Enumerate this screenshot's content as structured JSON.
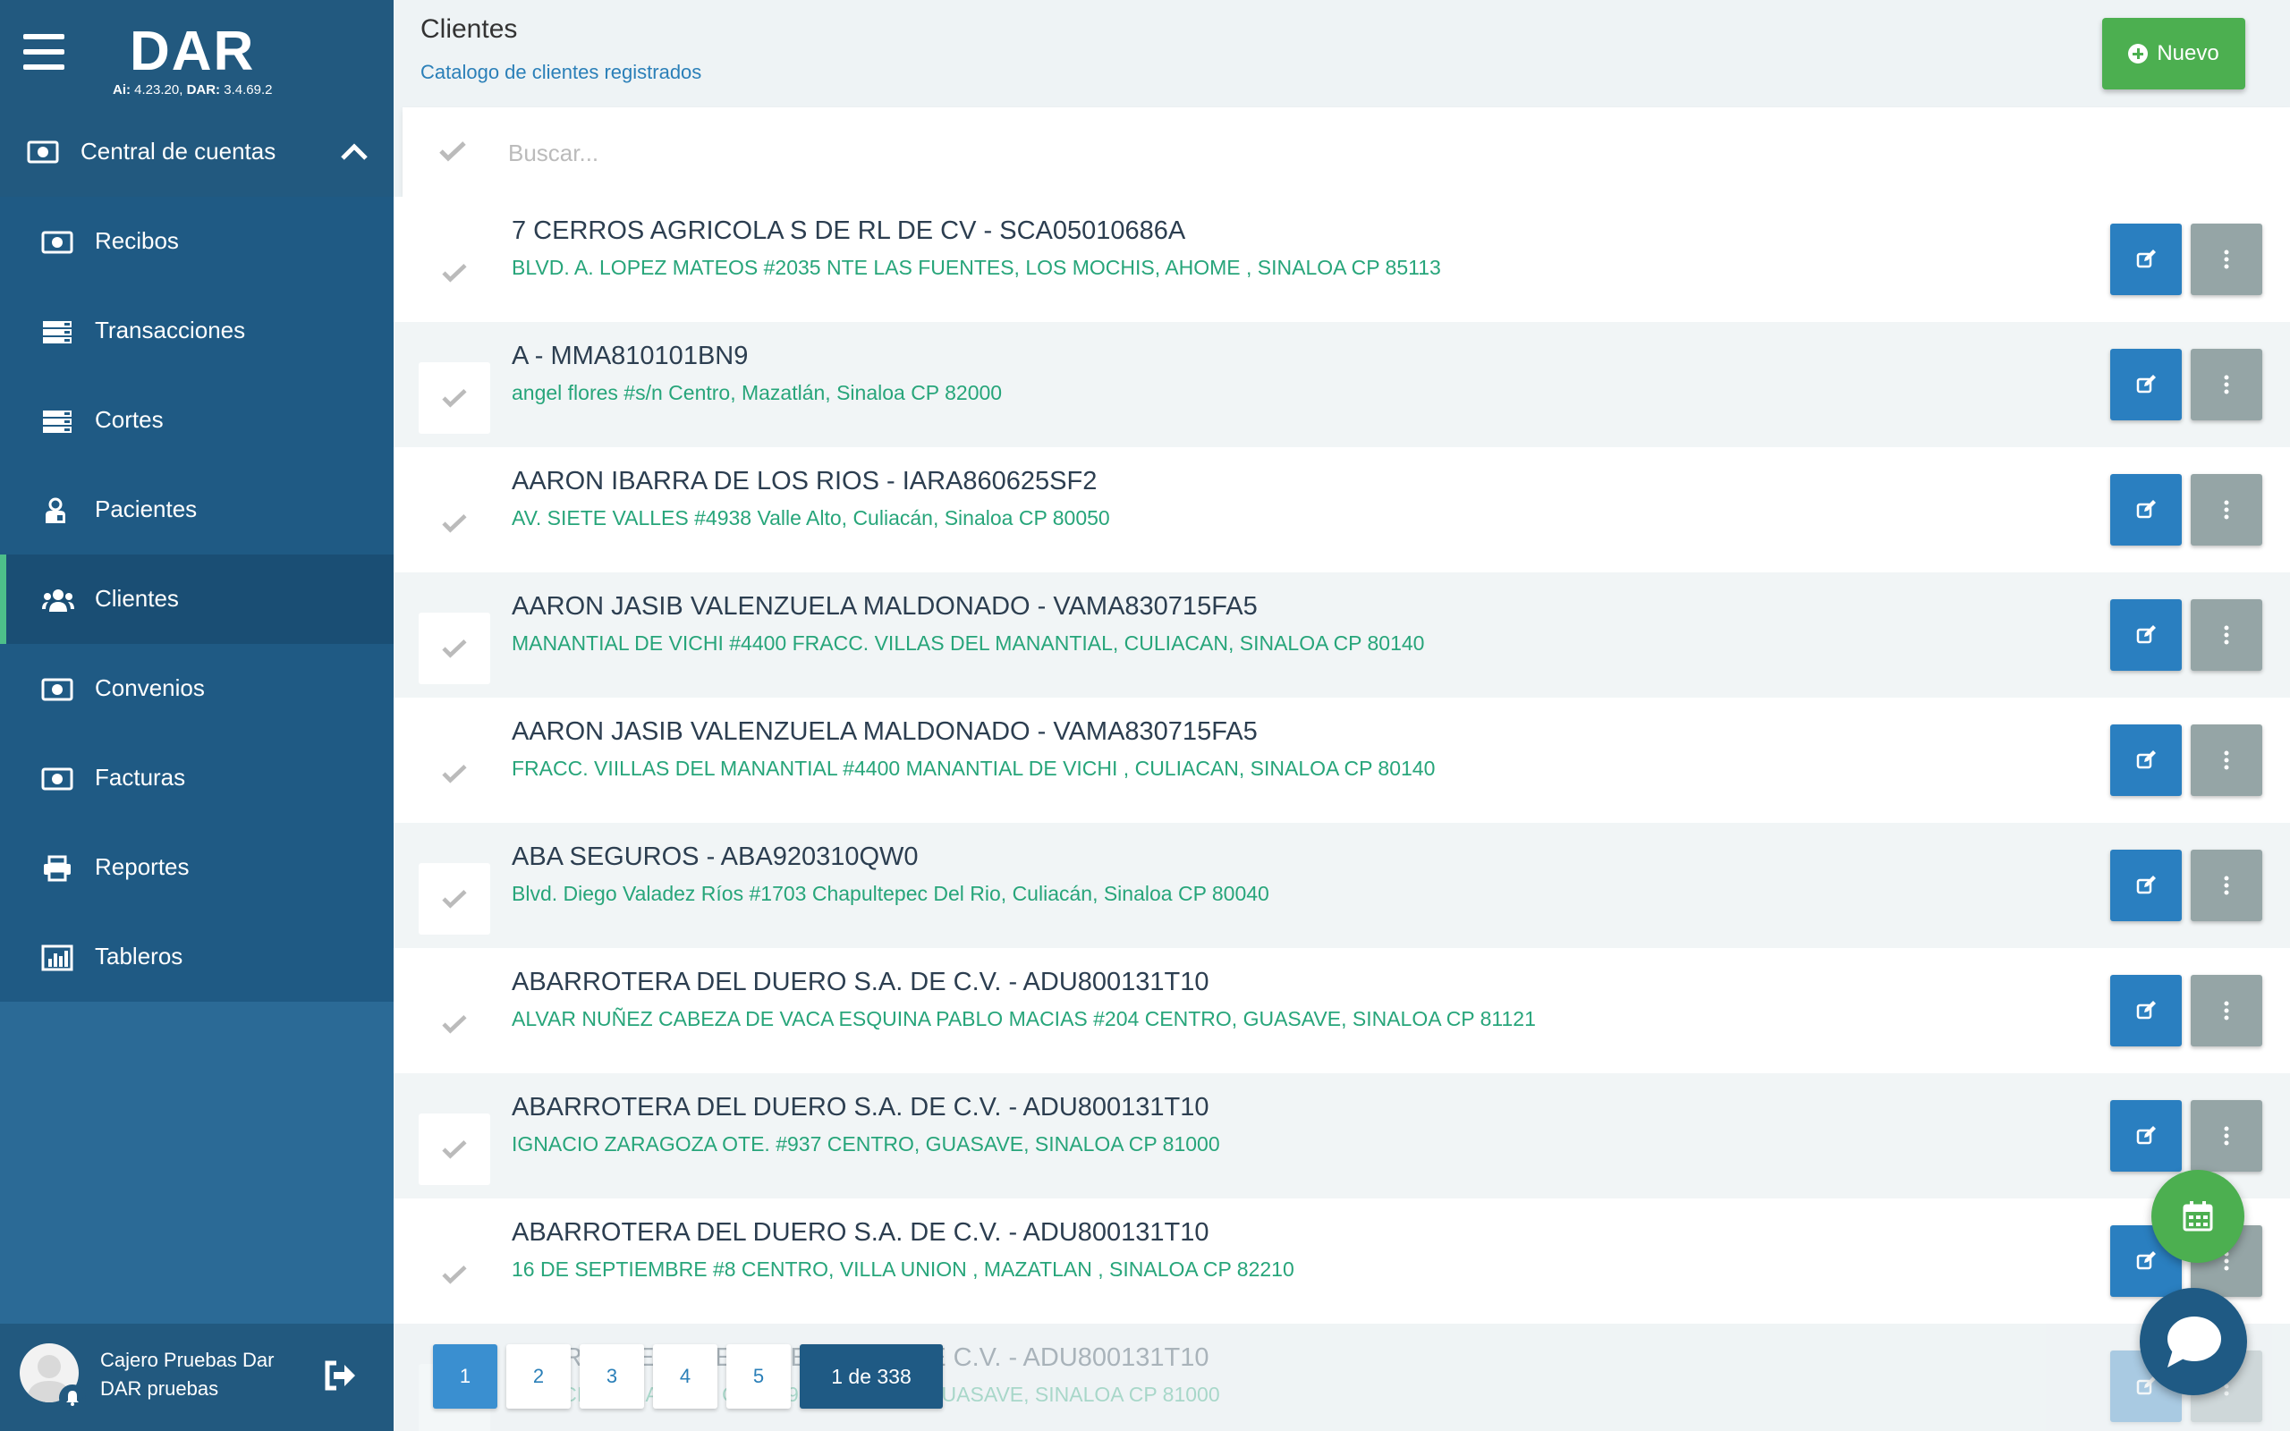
{
  "app": {
    "logo": "DAR",
    "version_ai_label": "Ai:",
    "version_ai": "4.23.20,",
    "version_dar_label": "DAR:",
    "version_dar": "3.4.69.2"
  },
  "sidebar": {
    "section_label": "Central de cuentas",
    "items": [
      {
        "label": "Recibos",
        "icon": "money-icon"
      },
      {
        "label": "Transacciones",
        "icon": "list-icon"
      },
      {
        "label": "Cortes",
        "icon": "list-icon"
      },
      {
        "label": "Pacientes",
        "icon": "user-icon"
      },
      {
        "label": "Clientes",
        "icon": "users-icon",
        "active": true
      },
      {
        "label": "Convenios",
        "icon": "money-icon"
      },
      {
        "label": "Facturas",
        "icon": "money-icon"
      },
      {
        "label": "Reportes",
        "icon": "printer-icon"
      },
      {
        "label": "Tableros",
        "icon": "bar-chart-icon"
      }
    ],
    "user": {
      "name": "Cajero Pruebas Dar",
      "role": "DAR pruebas"
    }
  },
  "header": {
    "title": "Clientes",
    "subtitle": "Catalogo de clientes registrados",
    "new_button": "Nuevo"
  },
  "search": {
    "placeholder": "Buscar..."
  },
  "clients": [
    {
      "name": "7 CERROS AGRICOLA S DE RL DE CV - SCA05010686A",
      "address": "BLVD. A. LOPEZ MATEOS #2035 NTE LAS FUENTES, LOS MOCHIS, AHOME , SINALOA CP 85113"
    },
    {
      "name": "A - MMA810101BN9",
      "address": "angel flores #s/n Centro, Mazatlán, Sinaloa CP 82000"
    },
    {
      "name": "AARON IBARRA DE LOS RIOS - IARA860625SF2",
      "address": "AV. SIETE VALLES #4938 Valle Alto, Culiacán, Sinaloa CP 80050"
    },
    {
      "name": "AARON JASIB VALENZUELA MALDONADO - VAMA830715FA5",
      "address": "MANANTIAL DE VICHI #4400 FRACC. VILLAS DEL MANANTIAL, CULIACAN, SINALOA CP 80140"
    },
    {
      "name": "AARON JASIB VALENZUELA MALDONADO - VAMA830715FA5",
      "address": "FRACC. VIILLAS DEL MANANTIAL #4400 MANANTIAL DE VICHI , CULIACAN, SINALOA CP 80140"
    },
    {
      "name": "ABA SEGUROS - ABA920310QW0",
      "address": "Blvd. Diego Valadez Ríos #1703 Chapultepec Del Rio, Culiacán, Sinaloa CP 80040"
    },
    {
      "name": "ABARROTERA DEL DUERO S.A. DE C.V. - ADU800131T10",
      "address": "ALVAR NUÑEZ CABEZA DE VACA ESQUINA PABLO MACIAS #204 CENTRO, GUASAVE, SINALOA CP 81121"
    },
    {
      "name": "ABARROTERA DEL DUERO S.A. DE C.V. - ADU800131T10",
      "address": "IGNACIO ZARAGOZA OTE. #937 CENTRO, GUASAVE, SINALOA CP 81000"
    },
    {
      "name": "ABARROTERA DEL DUERO S.A. DE C.V. - ADU800131T10",
      "address": "16 DE SEPTIEMBRE #8 CENTRO, VILLA UNION , MAZATLAN , SINALOA CP 82210"
    },
    {
      "name": "ABARROTERA DEL DUERO S.A. DE C.V. - ADU800131T10",
      "address": "IGNACIO ZARAGOZA OTE. #937 CENTRO, GUASAVE, SINALOA CP 81000"
    }
  ],
  "pagination": {
    "pages": [
      "1",
      "2",
      "3",
      "4",
      "5"
    ],
    "current": "1",
    "info": "1 de 338"
  },
  "colors": {
    "sidebar": "#2b6a96",
    "accent_green": "#4caf50",
    "edit_blue": "#2a7fc0",
    "address_green": "#27a57a"
  }
}
